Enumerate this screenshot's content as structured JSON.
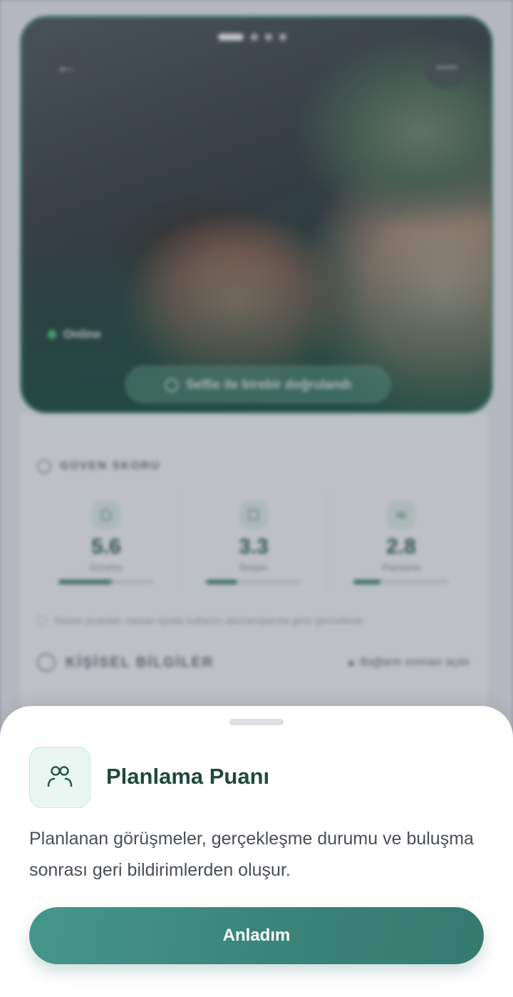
{
  "profile": {
    "back_icon": "arrow-left-icon",
    "menu_icon": "more-icon",
    "photo_count": 4,
    "active_photo": 1,
    "status": "Online",
    "verification_badge": "Selfie ile birebir doğrulandı"
  },
  "trust": {
    "section_title": "GÜVEN SKORU",
    "scores": [
      {
        "icon": "shield-icon",
        "value": "5.6",
        "label": "Durumu",
        "progress": 0.56
      },
      {
        "icon": "chat-icon",
        "value": "3.3",
        "label": "İletişim",
        "progress": 0.33
      },
      {
        "icon": "users-icon",
        "value": "2.8",
        "label": "Planlama",
        "progress": 0.28
      }
    ],
    "note": "Güven puanları zaman içinde kullanıcı davranışlarına göre güncellenir."
  },
  "personal": {
    "section_title": "KİŞİSEL BİLGİLER",
    "lock_text": "Bağlantı sonrası açılır"
  },
  "sheet": {
    "icon": "people-icon",
    "title": "Planlama Puanı",
    "description": "Planlanan görüşmeler, gerçekleşme durumu ve buluşma sonrası geri bildirimlerden oluşur.",
    "button_label": "Anladım"
  },
  "colors": {
    "accent": "#3a8479",
    "title": "#1f4a3e",
    "icon_bg": "#e9f6f1"
  }
}
